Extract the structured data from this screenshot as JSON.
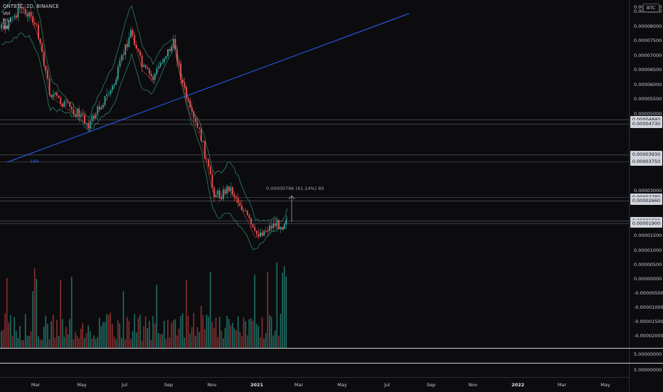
{
  "legend": {
    "symbol_line": "ONTBTC, 2D, BINANCE",
    "indicators": [
      "Vol",
      "RSI",
      "BB"
    ]
  },
  "currency": "BTC",
  "price_labels": [
    "0.00008500",
    "0.00008000",
    "0.00007500",
    "0.00007000",
    "0.00006500",
    "0.00006000",
    "0.00005500",
    "0.00005000",
    "0.00003000",
    "0.00002000",
    "0.00001500",
    "0.00001000",
    "0.00000500",
    "0.00000000",
    "-0.00000500",
    "-0.00001000",
    "-0.00001500",
    "-0.00002000"
  ],
  "price_label_values": [
    8500,
    8000,
    7500,
    7000,
    6500,
    6000,
    5500,
    5000,
    3000,
    2000,
    1500,
    1000,
    500,
    0,
    -500,
    -1000,
    -1500,
    -2000
  ],
  "badges": [
    "0.00004840",
    "0.00004730",
    "0.00003930",
    "0.00003750",
    "0.00002780",
    "0.00002660",
    "0.00001980",
    "0.00001900"
  ],
  "badge_values": [
    4840,
    4730,
    3930,
    3750,
    2780,
    2660,
    1980,
    1900
  ],
  "top_partial_label": "0.00009000",
  "lower_pane_values": [
    "5.00000000",
    "5.00000000"
  ],
  "time_labels": [
    "Mar",
    "May",
    "Jul",
    "Sep",
    "Nov",
    "2021",
    "Mar",
    "May",
    "Jul",
    "Sep",
    "Nov",
    "2022",
    "Mar",
    "May"
  ],
  "time_bold": [
    false,
    false,
    false,
    false,
    false,
    true,
    false,
    false,
    false,
    false,
    false,
    true,
    false,
    false
  ],
  "measure_label": "0.00000796 (41.14%) 80",
  "trendline_label": "169",
  "colors": {
    "up": "#26a69a",
    "down": "#ef5350",
    "trendline": "#2962ff",
    "bb": "#2f7f6b",
    "basis": "#c04343",
    "background": "#0c0c0f"
  }
}
